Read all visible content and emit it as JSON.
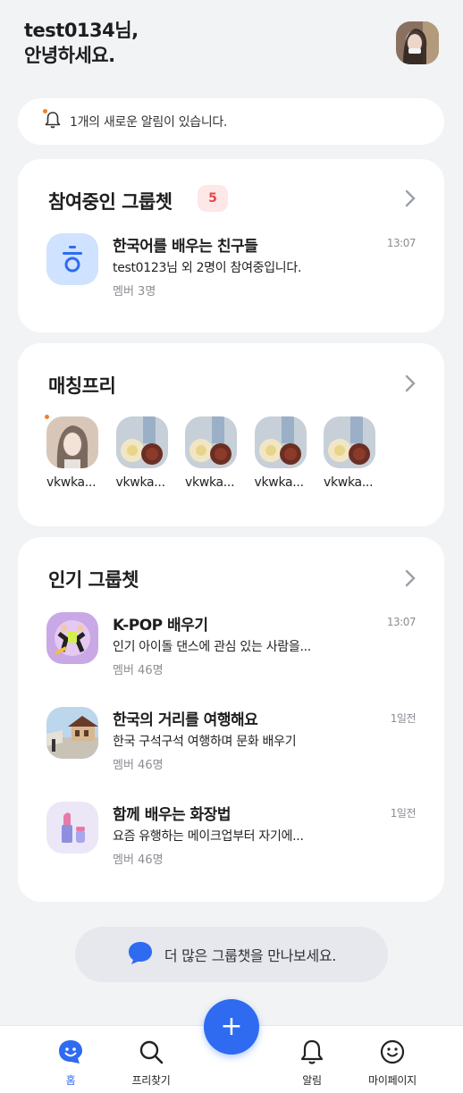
{
  "header": {
    "greeting_line1": "test0134님,",
    "greeting_line2": "안녕하세요."
  },
  "notice": {
    "text": "1개의 새로운 알림이 있습니다."
  },
  "joined": {
    "title": "참여중인 그룹쳇",
    "count": "5",
    "items": [
      {
        "icon_letter": "ㅎ",
        "title": "한국어를 배우는 친구들",
        "subtitle": "test0123님 외 2명이 참여중입니다.",
        "meta": "멤버 3명",
        "time": "13:07"
      }
    ]
  },
  "matching": {
    "title": "매칭프리",
    "friends": [
      {
        "name": "vkwka..."
      },
      {
        "name": "vkwka..."
      },
      {
        "name": "vkwka..."
      },
      {
        "name": "vkwka..."
      },
      {
        "name": "vkwka..."
      }
    ]
  },
  "popular": {
    "title": "인기 그룹쳇",
    "items": [
      {
        "title": "K-POP 배우기",
        "subtitle": "인기 아이돌 댄스에 관심 있는 사람을...",
        "meta": "멤버 46명",
        "time": "13:07"
      },
      {
        "title": "한국의 거리를 여행해요",
        "subtitle": "한국 구석구석 여행하며 문화 배우기",
        "meta": "멤버 46명",
        "time": "1일전"
      },
      {
        "title": "함께 배우는 화장법",
        "subtitle": "요즘 유행하는 메이크업부터 자기에...",
        "meta": "멤버 46명",
        "time": "1일전"
      }
    ]
  },
  "more_button": {
    "label": "더 많은 그룹챗을 만나보세요."
  },
  "tabbar": {
    "home": "홈",
    "search": "프리찾기",
    "alarm": "알림",
    "mypage": "마이페이지",
    "fab": "+"
  },
  "colors": {
    "accent": "#2e6bf0",
    "badge_bg": "#fde7e7",
    "badge_text": "#e5484d",
    "dot": "#f4802a"
  }
}
